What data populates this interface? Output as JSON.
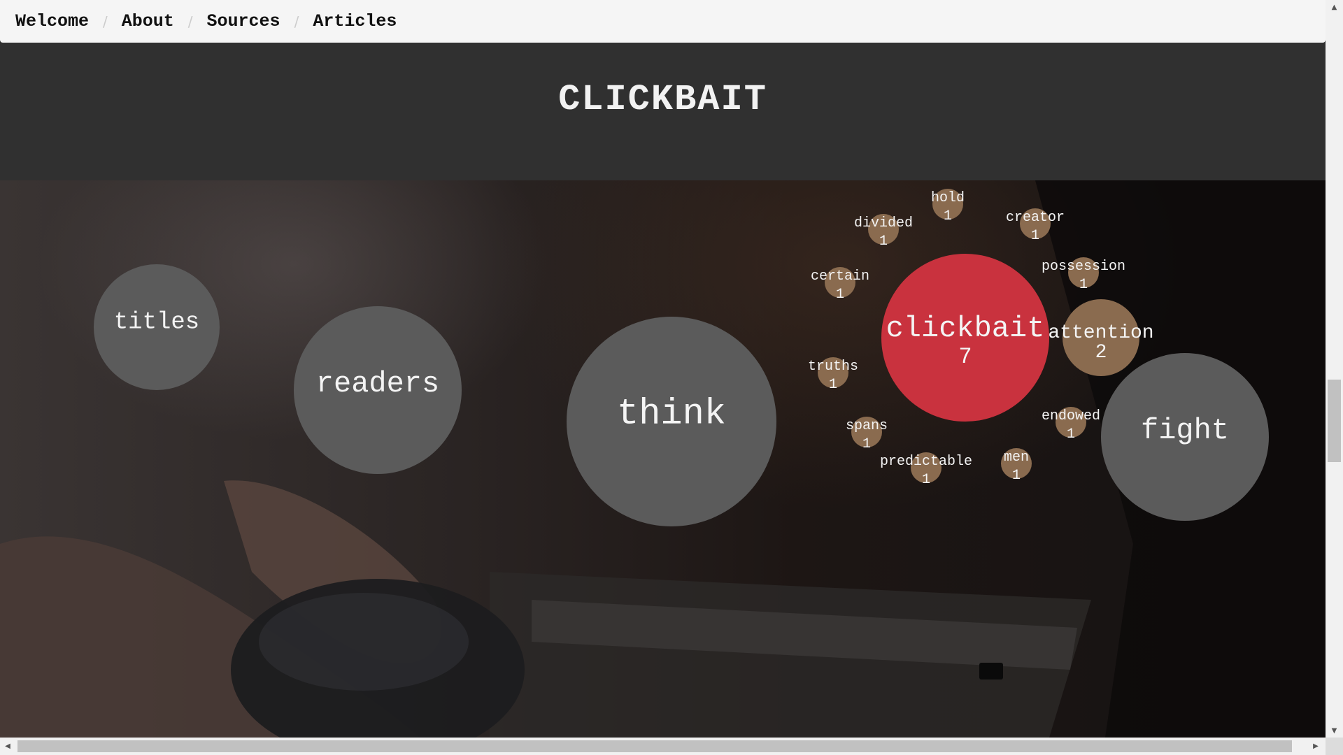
{
  "breadcrumb": {
    "items": [
      {
        "label": "Welcome"
      },
      {
        "label": "About"
      },
      {
        "label": "Sources"
      },
      {
        "label": "Articles"
      }
    ],
    "separator": "/"
  },
  "header": {
    "title": "CLICKBAIT"
  },
  "colors": {
    "navbar_bg": "#f5f5f5",
    "title_band_bg": "#303030",
    "highlight_bubble": "#c9323e",
    "related_bubble": "#8a6b4f",
    "keyword_bubble": "#5b5b5b"
  },
  "bubbles": {
    "keywords": [
      {
        "word": "titles"
      },
      {
        "word": "readers"
      },
      {
        "word": "think"
      },
      {
        "word": "fight"
      }
    ],
    "focus": {
      "word": "clickbait",
      "count": "7"
    },
    "related": [
      {
        "word": "hold",
        "count": "1"
      },
      {
        "word": "creator",
        "count": "1"
      },
      {
        "word": "divided",
        "count": "1"
      },
      {
        "word": "possession",
        "count": "1"
      },
      {
        "word": "certain",
        "count": "1"
      },
      {
        "word": "attention",
        "count": "2"
      },
      {
        "word": "truths",
        "count": "1"
      },
      {
        "word": "endowed",
        "count": "1"
      },
      {
        "word": "spans",
        "count": "1"
      },
      {
        "word": "predictable",
        "count": "1"
      },
      {
        "word": "men",
        "count": "1"
      }
    ]
  },
  "scrollbars": {
    "up_arrow": "▲",
    "down_arrow": "▼",
    "left_arrow": "◀",
    "right_arrow": "▶"
  }
}
